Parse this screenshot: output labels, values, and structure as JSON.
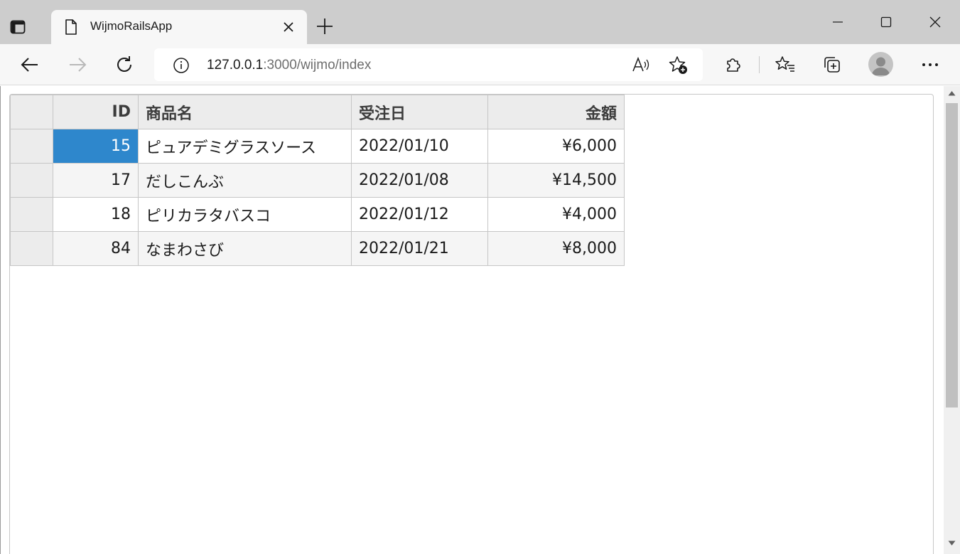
{
  "tab": {
    "title": "WijmoRailsApp"
  },
  "address": {
    "host": "127.0.0.1",
    "path": ":3000/wijmo/index"
  },
  "icons": {
    "tab_actions": "tab-actions-icon",
    "page": "page-icon",
    "close": "close-icon",
    "new_tab": "plus-icon",
    "minimize": "minimize-icon",
    "maximize": "maximize-icon",
    "window_close": "close-icon",
    "back": "back-arrow-icon",
    "forward": "forward-arrow-icon",
    "refresh": "refresh-icon",
    "info": "info-icon",
    "read_aloud": "read-aloud-icon",
    "add_favorite": "add-favorite-icon",
    "extensions": "extensions-icon",
    "favorites": "favorites-icon",
    "collections": "collections-icon",
    "profile": "profile-avatar-icon",
    "more": "more-icon"
  },
  "colors": {
    "selection": "#2e87cc",
    "header_bg": "#ececec",
    "alt_row_bg": "#f5f5f5"
  },
  "grid": {
    "columns": {
      "id": "ID",
      "name": "商品名",
      "date": "受注日",
      "amount": "金額"
    },
    "rows": [
      {
        "id": "15",
        "name": "ピュアデミグラスソース",
        "date": "2022/01/10",
        "amount": "¥6,000"
      },
      {
        "id": "17",
        "name": "だしこんぶ",
        "date": "2022/01/08",
        "amount": "¥14,500"
      },
      {
        "id": "18",
        "name": "ピリカラタバスコ",
        "date": "2022/01/12",
        "amount": "¥4,000"
      },
      {
        "id": "84",
        "name": "なまわさび",
        "date": "2022/01/21",
        "amount": "¥8,000"
      }
    ]
  }
}
